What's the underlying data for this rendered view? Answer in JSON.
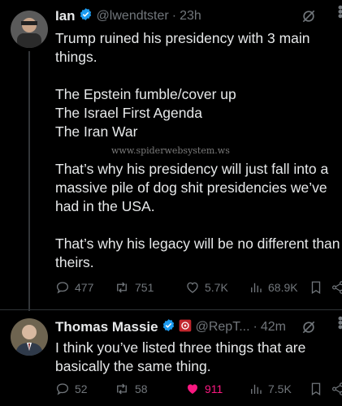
{
  "tweet1": {
    "name": "Ian",
    "handle": "@lwendtster",
    "separator": "·",
    "time": "23h",
    "lines": {
      "l1": "Trump ruined his presidency with 3 main",
      "l2": "things.",
      "l3": "The Epstein fumble/cover up",
      "l4": "The Israel First Agenda",
      "l5": "The Iran War",
      "l6": "That’s why his presidency will just fall into a",
      "l7": "massive pile of dog shit presidencies we’ve",
      "l8": "had in the USA.",
      "l9": "That’s why his legacy will be no different than",
      "l10": "theirs."
    },
    "replies": "477",
    "reposts": "751",
    "likes": "5.7K",
    "views": "68.9K"
  },
  "watermark": "www.spiderwebsystem.ws",
  "tweet2": {
    "name": "Thomas Massie",
    "handle": "@RepT...",
    "separator": "·",
    "time": "42m",
    "lines": {
      "l1": "I think you’ve listed three things that are",
      "l2": "basically the same thing."
    },
    "replies": "52",
    "reposts": "58",
    "likes": "911",
    "views": "7.5K"
  },
  "colors": {
    "background": "#000000",
    "text": "#e7e9ea",
    "muted": "#71767b",
    "verified": "#1d9bf0",
    "like": "#f91880"
  },
  "icons": [
    "verified-badge-icon",
    "grok-icon",
    "more-icon",
    "reply-icon",
    "repost-icon",
    "like-icon",
    "views-icon",
    "bookmark-icon",
    "share-icon"
  ]
}
